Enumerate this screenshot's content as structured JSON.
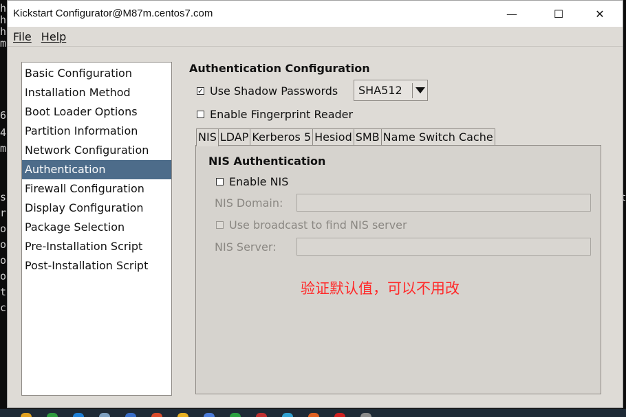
{
  "window": {
    "title": "Kickstart Configurator@M87m.centos7.com",
    "controls": {
      "minimize": "—",
      "maximize": "☐",
      "close": "✕"
    }
  },
  "menu": {
    "file": "File",
    "help": "Help"
  },
  "sidebar": {
    "selected_index": 5,
    "items": [
      {
        "label": "Basic Configuration"
      },
      {
        "label": "Installation Method"
      },
      {
        "label": "Boot Loader Options"
      },
      {
        "label": "Partition Information"
      },
      {
        "label": "Network Configuration"
      },
      {
        "label": "Authentication"
      },
      {
        "label": "Firewall Configuration"
      },
      {
        "label": "Display Configuration"
      },
      {
        "label": "Package Selection"
      },
      {
        "label": "Pre-Installation Script"
      },
      {
        "label": "Post-Installation Script"
      }
    ]
  },
  "main": {
    "title": "Authentication Configuration",
    "shadow_passwords": {
      "label": "Use Shadow Passwords",
      "checked": true,
      "mark": "✓"
    },
    "hash_select": {
      "value": "SHA512"
    },
    "fingerprint": {
      "label": "Enable Fingerprint Reader",
      "checked": false
    },
    "tabs": [
      {
        "label": "NIS"
      },
      {
        "label": "LDAP"
      },
      {
        "label": "Kerberos 5"
      },
      {
        "label": "Hesiod"
      },
      {
        "label": "SMB"
      },
      {
        "label": "Name Switch Cache"
      }
    ],
    "active_tab": 0,
    "nis": {
      "title": "NIS Authentication",
      "enable_label": "Enable NIS",
      "domain_label": "NIS Domain:",
      "domain_value": "",
      "broadcast_label": "Use broadcast to find NIS server",
      "server_label": "NIS Server:",
      "server_value": ""
    },
    "annotation": "验证默认值，可以不用改"
  },
  "background_terminal": {
    "left_chars": [
      "h",
      "h",
      "h",
      "m",
      "6",
      "4",
      "m",
      "s",
      "r",
      "o",
      "o",
      "o",
      "o",
      "t",
      "c"
    ],
    "right_chars": [
      "t"
    ]
  },
  "colors": {
    "selection": "#4d6c8a",
    "annotation": "#ff2a2a",
    "window_bg": "#dedbd6"
  }
}
